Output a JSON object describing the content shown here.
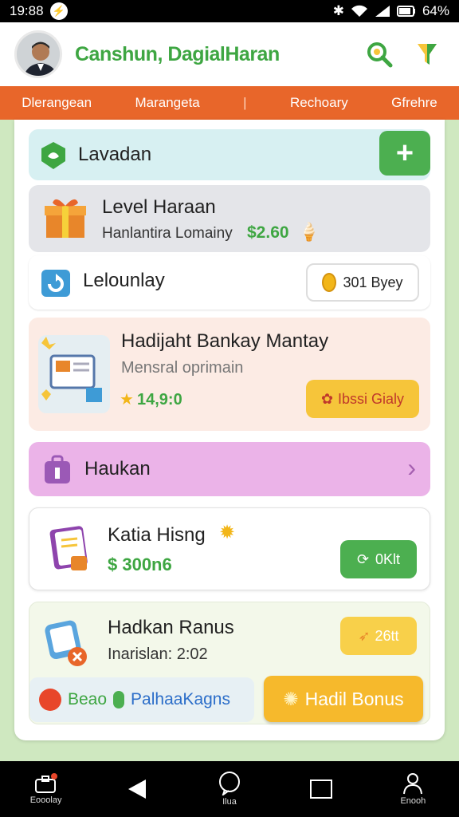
{
  "status_bar": {
    "time": "19:88",
    "battery": "64%"
  },
  "header": {
    "title": "Canshun, DagialHaran"
  },
  "tabs": [
    "Dlerangean",
    "Marangeta",
    "Rechoary",
    "Gfrehre"
  ],
  "cards": {
    "lavadan": {
      "title": "Lavadan"
    },
    "level": {
      "title": "Level Haraan",
      "subtitle": "Hanlantira Lomainy",
      "amount": "$2.60"
    },
    "leloun": {
      "title": "Lelounlay",
      "badge": "301 Byey"
    },
    "hadijaht": {
      "title": "Hadijaht Bankay Mantay",
      "subtitle": "Mensral oprimain",
      "stars": "14,9:0",
      "button": "Ibssi Gialy"
    },
    "haukan": {
      "title": "Haukan"
    },
    "katia": {
      "title": "Katia Hisng",
      "amount": "$ 300n6",
      "button": "0Klt"
    },
    "hadkan": {
      "title": "Hadkan Ranus",
      "subtitle": "Inarislan: 2:02",
      "button": "26tt",
      "chip_a": "Beao",
      "chip_b": "PalhaaKagns",
      "bonus_button": "Hadil Bonus"
    }
  },
  "nav": [
    "Eooolay",
    "Ilua",
    "Enooh"
  ],
  "colors": {
    "green": "#3ea642",
    "orange": "#e8662a",
    "yellow": "#f6c53a",
    "pink": "#ebb3e8"
  }
}
